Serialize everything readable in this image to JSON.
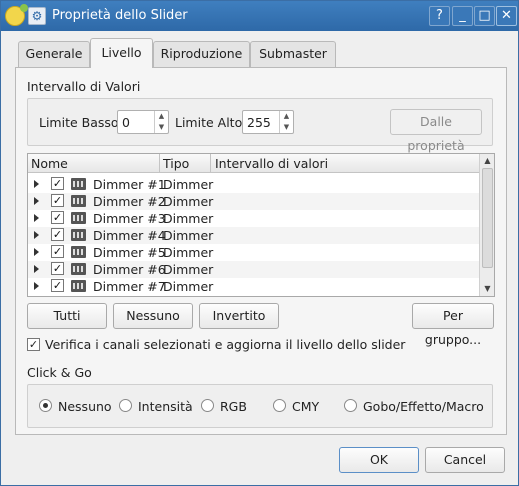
{
  "window": {
    "title": "Proprietà dello Slider",
    "sys_menu_glyph": "⚙",
    "controls": {
      "help": "?",
      "minimize": "_",
      "maximize": "□",
      "close": "✕"
    }
  },
  "tabs": [
    {
      "label": "Generale",
      "active": false
    },
    {
      "label": "Livello",
      "active": true
    },
    {
      "label": "Riproduzione",
      "active": false
    },
    {
      "label": "Submaster",
      "active": false
    }
  ],
  "range": {
    "group_title": "Intervallo di Valori",
    "low_label": "Limite Basso",
    "low_value": "0",
    "high_label": "Limite Alto",
    "high_value": "255",
    "from_props_label": "Dalle proprietà"
  },
  "tree": {
    "columns": [
      "Nome",
      "Tipo",
      "Intervallo di valori"
    ],
    "rows": [
      {
        "name": "Dimmer #1",
        "type": "Dimmer",
        "range": "",
        "checked": true
      },
      {
        "name": "Dimmer #2",
        "type": "Dimmer",
        "range": "",
        "checked": true
      },
      {
        "name": "Dimmer #3",
        "type": "Dimmer",
        "range": "",
        "checked": true
      },
      {
        "name": "Dimmer #4",
        "type": "Dimmer",
        "range": "",
        "checked": true
      },
      {
        "name": "Dimmer #5",
        "type": "Dimmer",
        "range": "",
        "checked": true
      },
      {
        "name": "Dimmer #6",
        "type": "Dimmer",
        "range": "",
        "checked": true
      },
      {
        "name": "Dimmer #7",
        "type": "Dimmer",
        "range": "",
        "checked": true
      }
    ],
    "check_glyph": "✓",
    "scroll_up": "▲",
    "scroll_down": "▼"
  },
  "selection_buttons": {
    "all": "Tutti",
    "none": "Nessuno",
    "invert": "Invertito",
    "by_group": "Per gruppo..."
  },
  "monitor": {
    "label": "Verifica i canali selezionati e aggiorna il livello dello slider",
    "checked": true
  },
  "click_go": {
    "title": "Click & Go",
    "options": [
      {
        "label": "Nessuno",
        "selected": true
      },
      {
        "label": "Intensità",
        "selected": false
      },
      {
        "label": "RGB",
        "selected": false
      },
      {
        "label": "CMY",
        "selected": false
      },
      {
        "label": "Gobo/Effetto/Macro",
        "selected": false
      }
    ]
  },
  "dialog_buttons": {
    "ok": "OK",
    "cancel": "Cancel"
  }
}
